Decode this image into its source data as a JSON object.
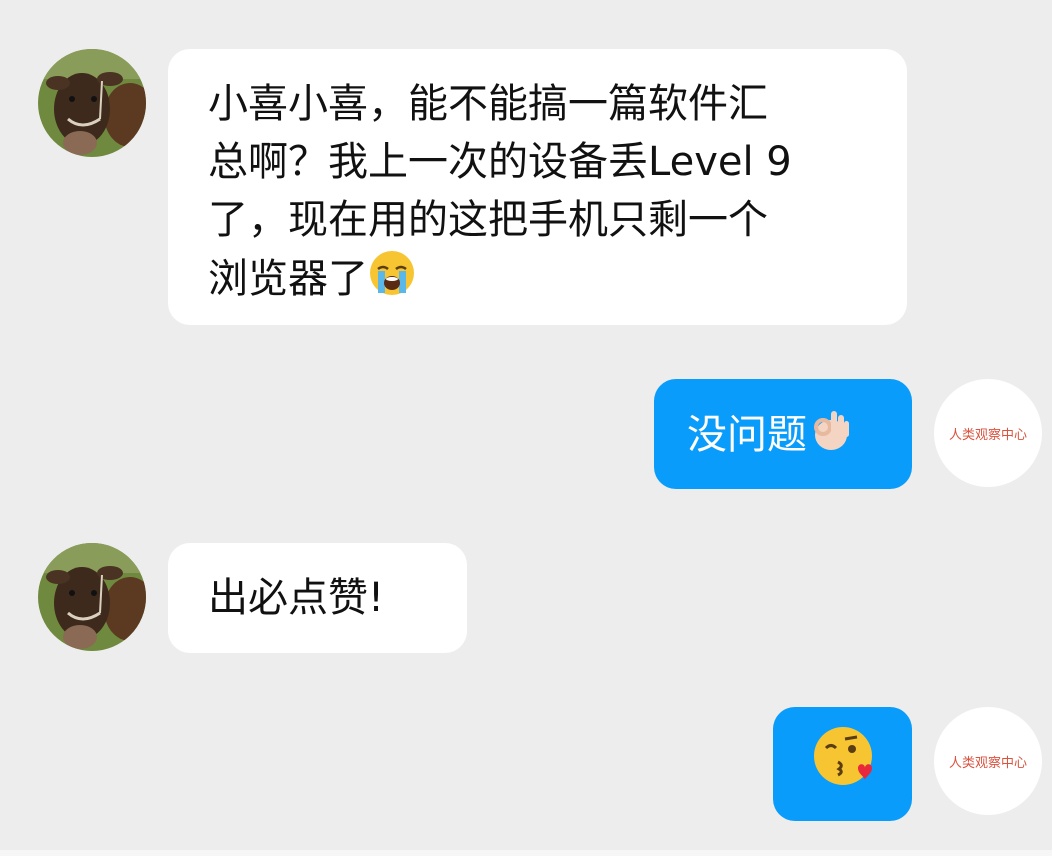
{
  "messages": [
    {
      "side": "left",
      "avatar": "cow-avatar-icon",
      "text": "小喜小喜，能不能搞一篇软件汇总啊？我上一次的设备丢Level 9了，现在用的这把手机只剩一个浏览器了",
      "line1": "小喜小喜，能不能搞一篇软件汇",
      "line2": "总啊？我上一次的设备丢Level 9",
      "line3": "了，现在用的这把手机只剩一个",
      "line4": "浏览器了",
      "emoji": "crying-face-emoji"
    },
    {
      "side": "right",
      "avatar_text": "人类观察中心",
      "text": "没问题",
      "emoji": "ok-hand-emoji"
    },
    {
      "side": "left",
      "avatar": "cow-avatar-icon",
      "text": "出必点赞!"
    },
    {
      "side": "right",
      "avatar_text": "人类观察中心",
      "text": "",
      "emoji": "face-blowing-kiss-emoji"
    }
  ],
  "colors": {
    "background": "#ededed",
    "incoming_bubble": "#ffffff",
    "outgoing_bubble": "#0a9cfb",
    "brand_text": "#d9533f"
  }
}
